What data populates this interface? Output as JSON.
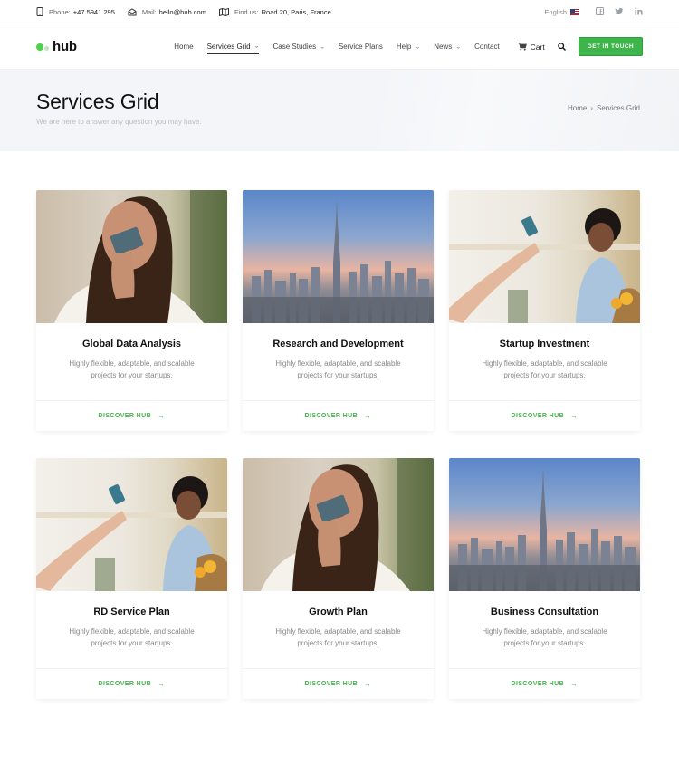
{
  "topbar": {
    "phone_label": "Phone:",
    "phone": "+47 5941 295",
    "mail_label": "Mail:",
    "mail": "hello@hub.com",
    "find_label": "Find us:",
    "address": "Road 20, Paris, France",
    "language": "English",
    "social": [
      "facebook-icon",
      "twitter-icon",
      "linkedin-icon"
    ]
  },
  "header": {
    "logo": "hub",
    "nav": [
      {
        "label": "Home",
        "dropdown": false
      },
      {
        "label": "Services Grid",
        "dropdown": true,
        "active": true
      },
      {
        "label": "Case Studies",
        "dropdown": true
      },
      {
        "label": "Service Plans",
        "dropdown": false
      },
      {
        "label": "Help",
        "dropdown": true
      },
      {
        "label": "News",
        "dropdown": true
      },
      {
        "label": "Contact",
        "dropdown": false
      }
    ],
    "cart": "Cart",
    "cta": "GET IN TOUCH"
  },
  "page": {
    "title": "Services Grid",
    "subtitle": "We are here to answer any question you may have.",
    "breadcrumb": [
      "Home",
      "Services Grid"
    ]
  },
  "cards": [
    {
      "title": "Global Data Analysis",
      "desc": "Highly flexible, adaptable, and scalable projects for your startups.",
      "link": "DISCOVER HUB",
      "image": "woman-card"
    },
    {
      "title": "Research and Development",
      "desc": "Highly flexible, adaptable, and scalable projects for your startups.",
      "link": "DISCOVER HUB",
      "image": "city"
    },
    {
      "title": "Startup Investment",
      "desc": "Highly flexible, adaptable, and scalable projects for your startups.",
      "link": "DISCOVER HUB",
      "image": "shop"
    },
    {
      "title": "RD Service Plan",
      "desc": "Highly flexible, adaptable, and scalable projects for your startups.",
      "link": "DISCOVER HUB",
      "image": "shop"
    },
    {
      "title": "Growth Plan",
      "desc": "Highly flexible, adaptable, and scalable projects for your startups.",
      "link": "DISCOVER HUB",
      "image": "woman-card"
    },
    {
      "title": "Business Consultation",
      "desc": "Highly flexible, adaptable, and scalable projects for your startups.",
      "link": "DISCOVER HUB",
      "image": "city"
    }
  ],
  "colors": {
    "accent": "#3eb54a",
    "link": "#46b34e"
  }
}
